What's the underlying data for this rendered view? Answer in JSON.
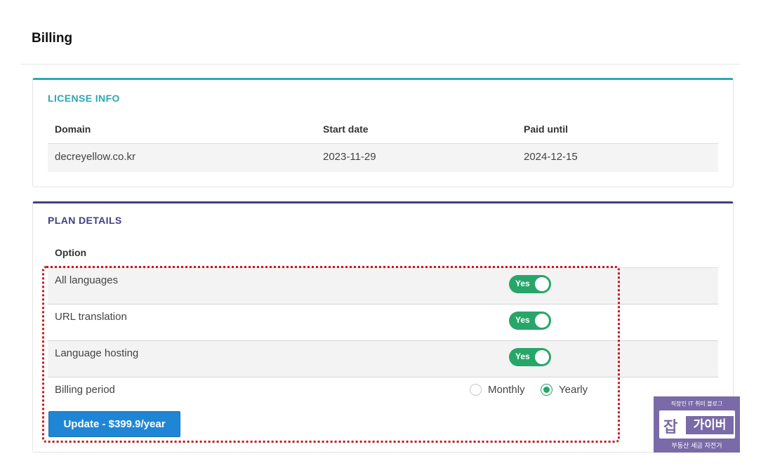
{
  "page": {
    "title": "Billing"
  },
  "license": {
    "title": "LICENSE INFO",
    "headers": {
      "domain": "Domain",
      "start": "Start date",
      "paid": "Paid until"
    },
    "row": {
      "domain": "decreyellow.co.kr",
      "start": "2023-11-29",
      "paid": "2024-12-15"
    }
  },
  "plan": {
    "title": "PLAN DETAILS",
    "header": "Option",
    "options": [
      {
        "label": "All languages",
        "toggle": "Yes"
      },
      {
        "label": "URL translation",
        "toggle": "Yes"
      },
      {
        "label": "Language hosting",
        "toggle": "Yes"
      }
    ],
    "billing": {
      "label": "Billing period",
      "monthly": "Monthly",
      "yearly": "Yearly",
      "selected": "Yearly"
    },
    "update_button": "Update - $399.9/year"
  },
  "watermark": {
    "top": "직장인 IT 취미 블로그",
    "left": "잡",
    "right": "가이버",
    "bottom": "부동산 세금 자전거"
  },
  "colors": {
    "license_accent": "#2aa9b6",
    "plan_accent": "#433f82",
    "toggle_on": "#27a66a",
    "button": "#1f86d6",
    "highlight": "#c8161d"
  }
}
